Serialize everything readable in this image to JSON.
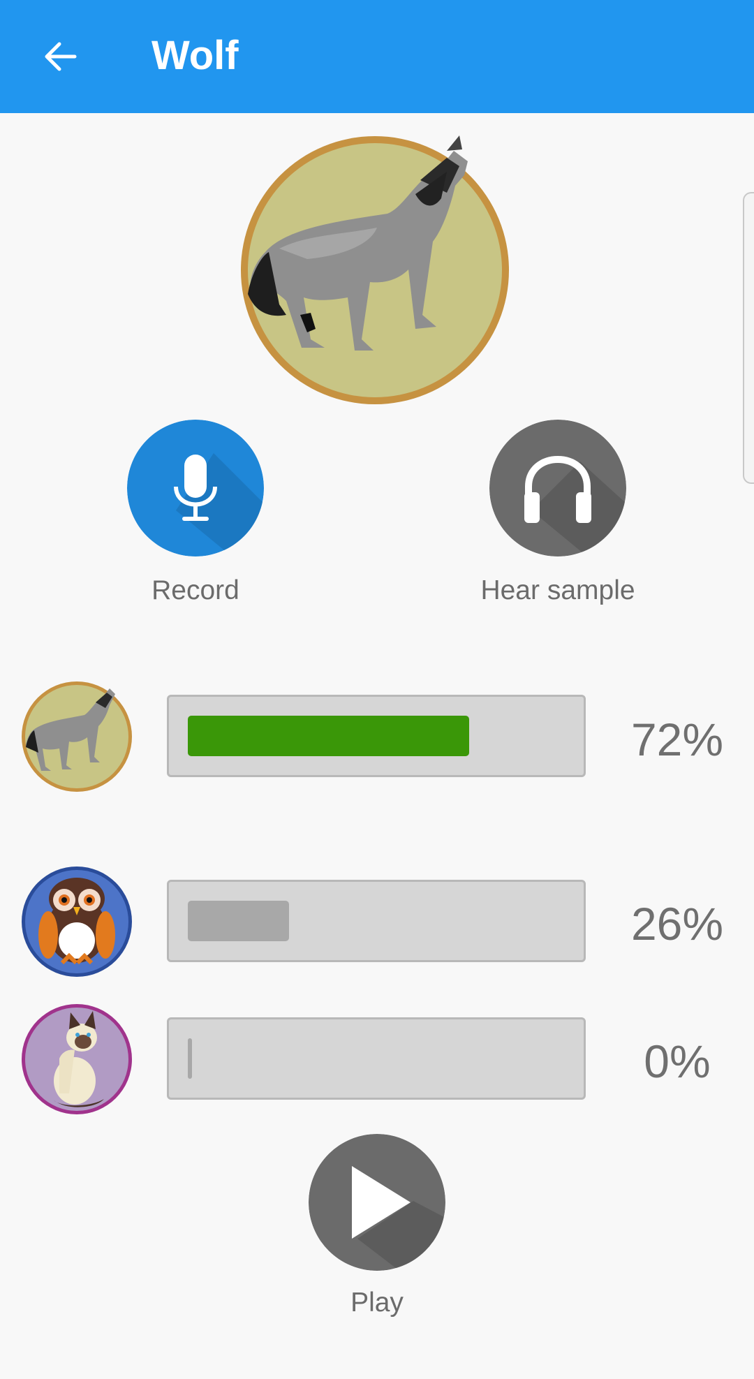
{
  "header": {
    "title": "Wolf",
    "back_icon": "arrow-back-icon",
    "color": "#2196ef"
  },
  "hero": {
    "image": "wolf-howling-image"
  },
  "actions": {
    "record_label": "Record",
    "record_icon": "microphone-icon",
    "hear_sample_label": "Hear sample",
    "hear_sample_icon": "headphones-icon",
    "play_label": "Play",
    "play_icon": "play-icon"
  },
  "results": [
    {
      "animal": "wolf",
      "avatar_icon": "wolf-avatar-icon",
      "percent_label": "72%",
      "value": 72,
      "bar_color": "#3a9708"
    },
    {
      "animal": "owl",
      "avatar_icon": "owl-avatar-icon",
      "percent_label": "26%",
      "value": 26,
      "bar_color": "#a8a8a8"
    },
    {
      "animal": "cat",
      "avatar_icon": "cat-avatar-icon",
      "percent_label": "0%",
      "value": 0,
      "bar_color": "#a8a8a8"
    }
  ]
}
